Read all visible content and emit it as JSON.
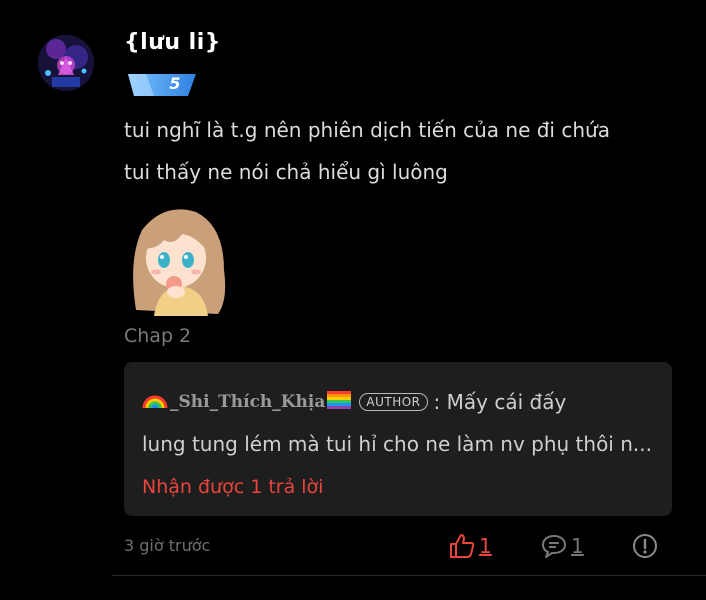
{
  "user": {
    "name": "{lưu li}",
    "level": "5"
  },
  "comment": {
    "lines": [
      "tui nghĩ là t.g nên phiên dịch tiến của ne đi chứa",
      "tui thấy ne nói chả hiểu gì luông"
    ],
    "chapter": "Chap 2"
  },
  "reply": {
    "author": "_Shi_Thích_Khịa",
    "author_badge": "AUTHOR",
    "text_start": ": Mấy cái đấy",
    "text_continued": "lung tung lém mà tui hỉ cho ne làm nv phụ thôi n...",
    "replies_label": "Nhận được 1 trả lời"
  },
  "footer": {
    "time": "3 giờ trước",
    "likes": "1",
    "comments": "1"
  },
  "colors": {
    "accent": "#e8453c",
    "badge_blue": "#3a8ee6",
    "reply_bg": "#1e1e1e"
  }
}
